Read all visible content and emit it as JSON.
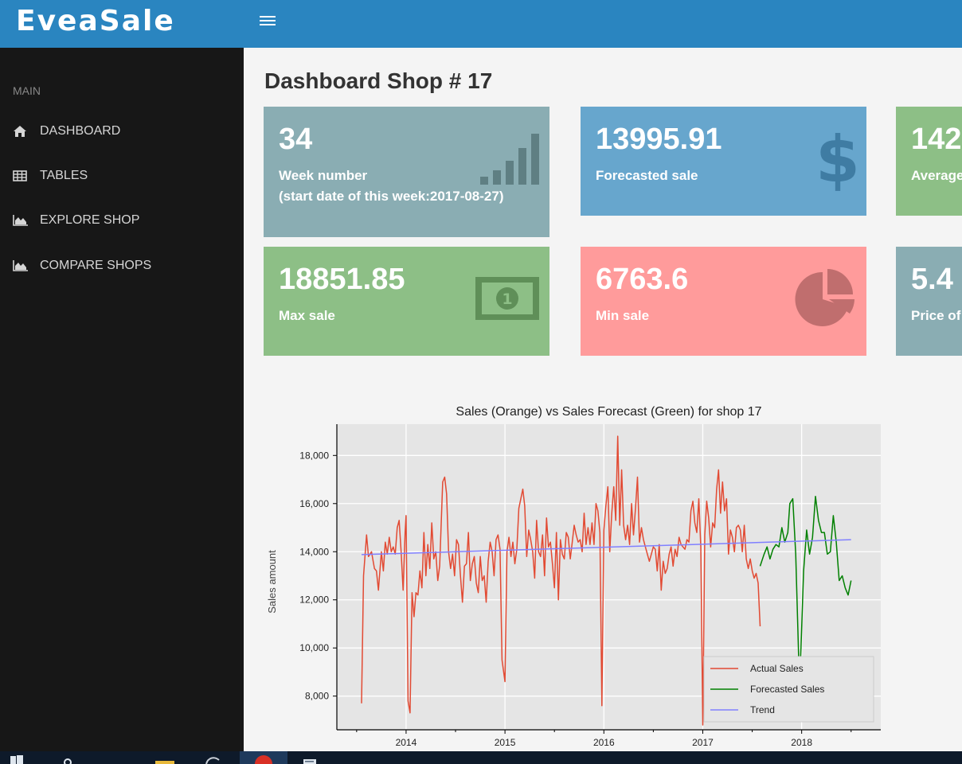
{
  "app": {
    "brand": "EveaSale"
  },
  "sidebar": {
    "heading": "MAIN",
    "items": [
      {
        "label": "DASHBOARD",
        "icon": "home-icon"
      },
      {
        "label": "TABLES",
        "icon": "table-icon"
      },
      {
        "label": "EXPLORE SHOP",
        "icon": "area-chart-icon"
      },
      {
        "label": "COMPARE SHOPS",
        "icon": "area-chart-icon"
      }
    ]
  },
  "page": {
    "title": "Dashboard Shop # 17"
  },
  "cards": [
    {
      "value": "34",
      "label": "Week number",
      "sublabel": "(start date of this week:2017-08-27)",
      "icon": "signal-bars-icon",
      "color": "#8aadb3"
    },
    {
      "value": "13995.91",
      "label": "Forecasted sale",
      "icon": "dollar-icon",
      "color": "#67a6cd"
    },
    {
      "value": "142",
      "label": "Average",
      "icon": "",
      "color": "#8dbf86"
    },
    {
      "value": "18851.85",
      "label": "Max sale",
      "icon": "money-bill-icon",
      "color": "#8dbf86"
    },
    {
      "value": "6763.6",
      "label": "Min sale",
      "icon": "pie-chart-icon",
      "color": "#ff9b9b"
    },
    {
      "value": "5.4",
      "label": "Price of",
      "icon": "",
      "color": "#8aadb3"
    }
  ],
  "chart_data": {
    "type": "line",
    "title": "Sales (Orange) vs Sales Forecast (Green) for shop 17",
    "xlabel": "",
    "ylabel": "Sales amount",
    "xlim": [
      2013.3,
      2018.8
    ],
    "ylim": [
      6600,
      19300
    ],
    "x_ticks": [
      2014,
      2015,
      2016,
      2017,
      2018
    ],
    "y_ticks": [
      8000,
      10000,
      12000,
      14000,
      16000,
      18000
    ],
    "y_tick_labels": [
      "8,000",
      "10,000",
      "12,000",
      "14,000",
      "16,000",
      "18,000"
    ],
    "grid": true,
    "legend_position": "bottom-right",
    "series": [
      {
        "name": "Actual Sales",
        "color": "#e24a33",
        "points": [
          [
            2013.55,
            7700
          ],
          [
            2013.57,
            13000
          ],
          [
            2013.6,
            14700
          ],
          [
            2013.62,
            13800
          ],
          [
            2013.65,
            14000
          ],
          [
            2013.68,
            13300
          ],
          [
            2013.7,
            13200
          ],
          [
            2013.72,
            12400
          ],
          [
            2013.75,
            14000
          ],
          [
            2013.77,
            13200
          ],
          [
            2013.79,
            14400
          ],
          [
            2013.81,
            13900
          ],
          [
            2013.83,
            14600
          ],
          [
            2013.85,
            14000
          ],
          [
            2013.87,
            14200
          ],
          [
            2013.89,
            13900
          ],
          [
            2013.91,
            15000
          ],
          [
            2013.93,
            15300
          ],
          [
            2013.95,
            14000
          ],
          [
            2013.97,
            12400
          ],
          [
            2013.99,
            14800
          ],
          [
            2014.0,
            15500
          ],
          [
            2014.02,
            7800
          ],
          [
            2014.04,
            7300
          ],
          [
            2014.06,
            12300
          ],
          [
            2014.08,
            11300
          ],
          [
            2014.1,
            12300
          ],
          [
            2014.12,
            12200
          ],
          [
            2014.14,
            13200
          ],
          [
            2014.16,
            12500
          ],
          [
            2014.18,
            14800
          ],
          [
            2014.2,
            13000
          ],
          [
            2014.22,
            14300
          ],
          [
            2014.24,
            13300
          ],
          [
            2014.26,
            15200
          ],
          [
            2014.28,
            13700
          ],
          [
            2014.3,
            14000
          ],
          [
            2014.32,
            12800
          ],
          [
            2014.34,
            13400
          ],
          [
            2014.37,
            16900
          ],
          [
            2014.39,
            17100
          ],
          [
            2014.41,
            16400
          ],
          [
            2014.43,
            14000
          ],
          [
            2014.45,
            13300
          ],
          [
            2014.47,
            13900
          ],
          [
            2014.49,
            13000
          ],
          [
            2014.51,
            14500
          ],
          [
            2014.53,
            14300
          ],
          [
            2014.55,
            13000
          ],
          [
            2014.57,
            11900
          ],
          [
            2014.59,
            13400
          ],
          [
            2014.61,
            13500
          ],
          [
            2014.63,
            14800
          ],
          [
            2014.65,
            12800
          ],
          [
            2014.67,
            13500
          ],
          [
            2014.69,
            13800
          ],
          [
            2014.71,
            12700
          ],
          [
            2014.73,
            12300
          ],
          [
            2014.75,
            13800
          ],
          [
            2014.77,
            12800
          ],
          [
            2014.79,
            13000
          ],
          [
            2014.81,
            11900
          ],
          [
            2014.83,
            13600
          ],
          [
            2014.85,
            14400
          ],
          [
            2014.87,
            14000
          ],
          [
            2014.89,
            13000
          ],
          [
            2014.91,
            14500
          ],
          [
            2014.93,
            14700
          ],
          [
            2014.95,
            14100
          ],
          [
            2014.97,
            9500
          ],
          [
            2015.0,
            8600
          ],
          [
            2015.02,
            14000
          ],
          [
            2015.04,
            14600
          ],
          [
            2015.06,
            13800
          ],
          [
            2015.08,
            14400
          ],
          [
            2015.1,
            13500
          ],
          [
            2015.12,
            14100
          ],
          [
            2015.14,
            15800
          ],
          [
            2015.16,
            16200
          ],
          [
            2015.18,
            16600
          ],
          [
            2015.2,
            15900
          ],
          [
            2015.22,
            13800
          ],
          [
            2015.24,
            14900
          ],
          [
            2015.26,
            14500
          ],
          [
            2015.28,
            14000
          ],
          [
            2015.3,
            12900
          ],
          [
            2015.32,
            15300
          ],
          [
            2015.34,
            14000
          ],
          [
            2015.36,
            13800
          ],
          [
            2015.38,
            14700
          ],
          [
            2015.4,
            13000
          ],
          [
            2015.42,
            15400
          ],
          [
            2015.44,
            14200
          ],
          [
            2015.46,
            14400
          ],
          [
            2015.48,
            13500
          ],
          [
            2015.5,
            12500
          ],
          [
            2015.52,
            14800
          ],
          [
            2015.54,
            12000
          ],
          [
            2015.56,
            14500
          ],
          [
            2015.58,
            13900
          ],
          [
            2015.6,
            13700
          ],
          [
            2015.62,
            14800
          ],
          [
            2015.64,
            14600
          ],
          [
            2015.66,
            13700
          ],
          [
            2015.68,
            14400
          ],
          [
            2015.7,
            15100
          ],
          [
            2015.72,
            14700
          ],
          [
            2015.74,
            14400
          ],
          [
            2015.76,
            14500
          ],
          [
            2015.78,
            14000
          ],
          [
            2015.8,
            15600
          ],
          [
            2015.82,
            14300
          ],
          [
            2015.84,
            15000
          ],
          [
            2015.86,
            14300
          ],
          [
            2015.88,
            15200
          ],
          [
            2015.9,
            14300
          ],
          [
            2015.92,
            16000
          ],
          [
            2015.94,
            15700
          ],
          [
            2015.96,
            14800
          ],
          [
            2015.98,
            7600
          ],
          [
            2016.0,
            14900
          ],
          [
            2016.02,
            15900
          ],
          [
            2016.04,
            16700
          ],
          [
            2016.06,
            14000
          ],
          [
            2016.08,
            15600
          ],
          [
            2016.1,
            16700
          ],
          [
            2016.12,
            15300
          ],
          [
            2016.14,
            18800
          ],
          [
            2016.16,
            15100
          ],
          [
            2016.18,
            17400
          ],
          [
            2016.2,
            15100
          ],
          [
            2016.22,
            14500
          ],
          [
            2016.24,
            15100
          ],
          [
            2016.26,
            14300
          ],
          [
            2016.28,
            16000
          ],
          [
            2016.3,
            14700
          ],
          [
            2016.32,
            15800
          ],
          [
            2016.34,
            17100
          ],
          [
            2016.36,
            14400
          ],
          [
            2016.38,
            15000
          ],
          [
            2016.4,
            14500
          ],
          [
            2016.42,
            14200
          ],
          [
            2016.44,
            13900
          ],
          [
            2016.46,
            13600
          ],
          [
            2016.48,
            13900
          ],
          [
            2016.5,
            14200
          ],
          [
            2016.52,
            14100
          ],
          [
            2016.54,
            13200
          ],
          [
            2016.56,
            14300
          ],
          [
            2016.58,
            12400
          ],
          [
            2016.6,
            13600
          ],
          [
            2016.62,
            13100
          ],
          [
            2016.64,
            13300
          ],
          [
            2016.66,
            13900
          ],
          [
            2016.68,
            14200
          ],
          [
            2016.7,
            13400
          ],
          [
            2016.72,
            14100
          ],
          [
            2016.74,
            13800
          ],
          [
            2016.76,
            14600
          ],
          [
            2016.78,
            14300
          ],
          [
            2016.8,
            14200
          ],
          [
            2016.82,
            14100
          ],
          [
            2016.84,
            14500
          ],
          [
            2016.86,
            14400
          ],
          [
            2016.88,
            15700
          ],
          [
            2016.9,
            16100
          ],
          [
            2016.92,
            15200
          ],
          [
            2016.94,
            14800
          ],
          [
            2016.96,
            16200
          ],
          [
            2016.98,
            14200
          ],
          [
            2017.0,
            6800
          ],
          [
            2017.02,
            14700
          ],
          [
            2017.04,
            16100
          ],
          [
            2017.06,
            15400
          ],
          [
            2017.08,
            14200
          ],
          [
            2017.1,
            15200
          ],
          [
            2017.12,
            15000
          ],
          [
            2017.14,
            16600
          ],
          [
            2017.16,
            17400
          ],
          [
            2017.18,
            15600
          ],
          [
            2017.2,
            16900
          ],
          [
            2017.22,
            15700
          ],
          [
            2017.24,
            16200
          ],
          [
            2017.26,
            13900
          ],
          [
            2017.28,
            14900
          ],
          [
            2017.3,
            14600
          ],
          [
            2017.32,
            14000
          ],
          [
            2017.34,
            15000
          ],
          [
            2017.36,
            15100
          ],
          [
            2017.38,
            14900
          ],
          [
            2017.4,
            14000
          ],
          [
            2017.42,
            15100
          ],
          [
            2017.44,
            13700
          ],
          [
            2017.46,
            13300
          ],
          [
            2017.48,
            13700
          ],
          [
            2017.5,
            13200
          ],
          [
            2017.52,
            12900
          ],
          [
            2017.54,
            13100
          ],
          [
            2017.56,
            12700
          ],
          [
            2017.58,
            10900
          ]
        ]
      },
      {
        "name": "Forecasted Sales",
        "color": "#008000",
        "points": [
          [
            2017.58,
            13400
          ],
          [
            2017.62,
            13900
          ],
          [
            2017.65,
            14200
          ],
          [
            2017.68,
            13700
          ],
          [
            2017.71,
            14100
          ],
          [
            2017.74,
            14300
          ],
          [
            2017.77,
            14200
          ],
          [
            2017.8,
            15000
          ],
          [
            2017.83,
            14400
          ],
          [
            2017.86,
            14800
          ],
          [
            2017.88,
            16000
          ],
          [
            2017.91,
            16200
          ],
          [
            2017.94,
            13900
          ],
          [
            2017.97,
            9600
          ],
          [
            2017.99,
            9600
          ],
          [
            2018.02,
            13200
          ],
          [
            2018.05,
            14900
          ],
          [
            2018.08,
            13900
          ],
          [
            2018.11,
            14600
          ],
          [
            2018.14,
            16300
          ],
          [
            2018.17,
            15300
          ],
          [
            2018.2,
            14800
          ],
          [
            2018.23,
            14800
          ],
          [
            2018.26,
            13900
          ],
          [
            2018.29,
            14000
          ],
          [
            2018.32,
            15500
          ],
          [
            2018.35,
            14400
          ],
          [
            2018.38,
            12800
          ],
          [
            2018.41,
            13000
          ],
          [
            2018.44,
            12500
          ],
          [
            2018.47,
            12200
          ],
          [
            2018.5,
            12800
          ]
        ]
      },
      {
        "name": "Trend",
        "color": "#8080ff",
        "points": [
          [
            2013.55,
            13880
          ],
          [
            2018.5,
            14500
          ]
        ]
      }
    ]
  }
}
